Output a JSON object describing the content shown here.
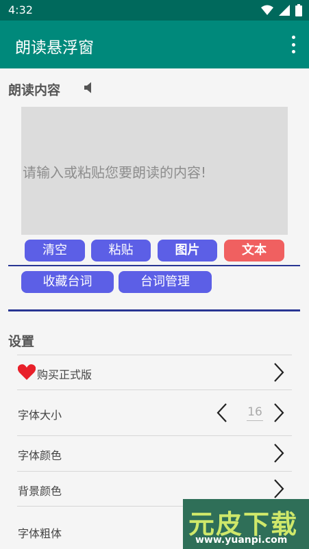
{
  "status_bar": {
    "time": "4:32"
  },
  "app_bar": {
    "title": "朗读悬浮窗"
  },
  "read_section": {
    "title": "朗读内容",
    "input_placeholder": "请输入或粘贴您要朗读的内容!"
  },
  "buttons": {
    "clear": "清空",
    "paste": "粘贴",
    "image": "图片",
    "text": "文本",
    "favorite_lines": "收藏台词",
    "manage_lines": "台词管理"
  },
  "settings": {
    "title": "设置",
    "purchase": "购买正式版",
    "font_size_label": "字体大小",
    "font_size_value": "16",
    "font_color": "字体颜色",
    "background_color": "背景颜色",
    "font_bold": "字体粗体"
  },
  "watermark": {
    "top": "元皮下载",
    "bottom": "www.yuanpi.com"
  },
  "colors": {
    "status_bar": "#00695c",
    "app_bar": "#00897b",
    "button": "#5c5fe6",
    "button_active": "#f06060",
    "divider": "#283593"
  }
}
